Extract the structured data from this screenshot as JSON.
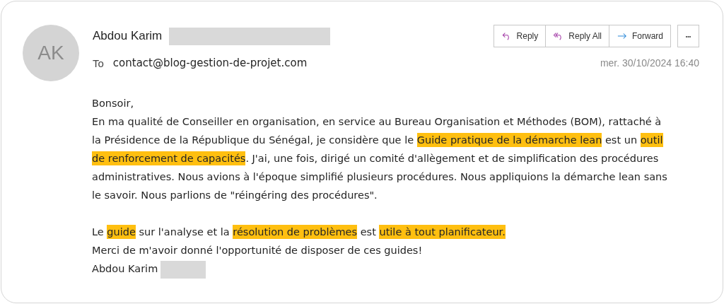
{
  "sender": {
    "initials": "AK",
    "name": "Abdou Karim",
    "redacted": true
  },
  "recipient": {
    "label": "To",
    "address": "contact@blog-gestion-de-projet.com"
  },
  "actions": [
    {
      "kind": "reply",
      "label": "Reply"
    },
    {
      "kind": "reply_all",
      "label": "Reply All"
    },
    {
      "kind": "forward",
      "label": "Forward"
    }
  ],
  "more": "•••",
  "date": "mer. 30/10/2024 16:40",
  "paragraphs": [
    {
      "lines": [
        [
          {
            "text": "Bonsoir,",
            "highlighted": false
          }
        ],
        [
          {
            "text": "En ma qualité de Conseiller en organisation, en service au Bureau Organisation et Méthodes (BOM), rattaché à",
            "highlighted": false
          }
        ],
        [
          {
            "text": "la Présidence de la République du Sénégal, je considère que le ",
            "highlighted": false
          },
          {
            "text": "Guide pratique de la démarche lean",
            "highlighted": true
          },
          {
            "text": " est un ",
            "highlighted": false
          },
          {
            "text": "outil",
            "highlighted": true
          }
        ],
        [
          {
            "text": "de renforcement de capacités",
            "highlighted": true
          },
          {
            "text": ". J'ai, une fois, dirigé un comité d'allègement et de simplification des procédures",
            "highlighted": false
          }
        ],
        [
          {
            "text": "administratives. Nous avions à l'époque simplifié plusieurs procédures. Nous appliquions la démarche lean sans",
            "highlighted": false
          }
        ],
        [
          {
            "text": "le savoir. Nous parlions de \"réingéring des procédures\".",
            "highlighted": false
          }
        ]
      ]
    },
    {
      "lines": [
        [
          {
            "text": "Le ",
            "highlighted": false
          },
          {
            "text": "guide",
            "highlighted": true
          },
          {
            "text": " sur l'analyse et la ",
            "highlighted": false
          },
          {
            "text": "résolution de problèmes",
            "highlighted": true
          },
          {
            "text": " est ",
            "highlighted": false
          },
          {
            "text": "utile à tout planificateur.",
            "highlighted": true
          }
        ],
        [
          {
            "text": "Merci de m'avoir donné l'opportunité de disposer de ces guides!",
            "highlighted": false
          }
        ]
      ]
    }
  ],
  "signature": {
    "name": "Abdou Karim",
    "redacted": true
  }
}
